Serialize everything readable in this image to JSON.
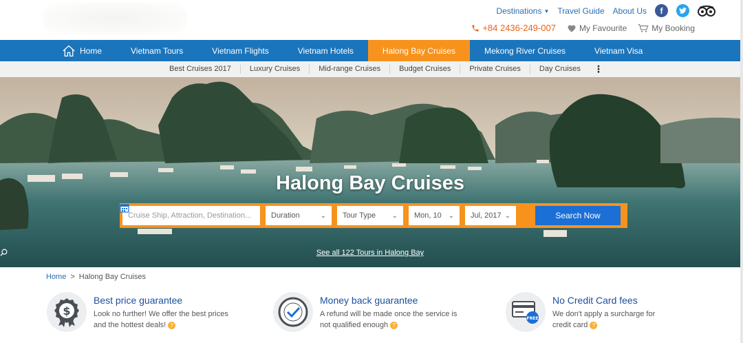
{
  "top": {
    "links": [
      "Destinations",
      "Travel Guide",
      "About Us"
    ],
    "phone": "+84 2436-249-007",
    "favourite": "My Favourite",
    "booking": "My Booking"
  },
  "nav": {
    "home": "Home",
    "items": [
      "Vietnam Tours",
      "Vietnam Flights",
      "Vietnam Hotels",
      "Halong Bay Cruises",
      "Mekong River Cruises",
      "Vietnam Visa"
    ],
    "active": "Halong Bay Cruises"
  },
  "subnav": [
    "Best Cruises 2017",
    "Luxury Cruises",
    "Mid-range Cruises",
    "Budget Cruises",
    "Private Cruises",
    "Day Cruises"
  ],
  "hero": {
    "title": "Halong Bay Cruises",
    "search_placeholder": "Cruise Ship, Attraction, Destination...",
    "duration": "Duration",
    "tour_type": "Tour Type",
    "day": "Mon, 10",
    "month": "Jul, 2017",
    "search_button": "Search Now",
    "see_all": "See all 122 Tours in Halong Bay"
  },
  "breadcrumb": {
    "home": "Home",
    "sep": ">",
    "current": "Halong Bay Cruises"
  },
  "features": [
    {
      "title": "Best price guarantee",
      "line1": "Look no further! We offer the best prices",
      "line2": "and the hottest deals!"
    },
    {
      "title": "Money back guarantee",
      "line1": "A refund will be made once the service is",
      "line2": "not qualified enough"
    },
    {
      "title": "No Credit Card fees",
      "line1": "We don't apply a surcharge for",
      "line2": "credit card"
    }
  ],
  "colors": {
    "primary": "#1b75bc",
    "accent": "#f7931d",
    "button": "#1b6fd6"
  }
}
